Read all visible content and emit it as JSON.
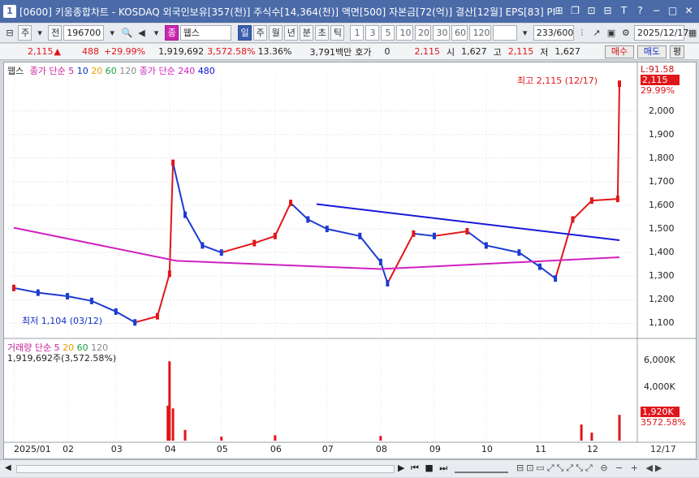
{
  "window": {
    "code": "[0600]",
    "title": "키움종합차트 - KOSDAQ 외국인보유[357(천)] 주식수[14,364(천)] 액면[500] 자본금[72(억)] 결산[12월] EPS[83] PI"
  },
  "toolbar": {
    "market": "주",
    "type": "전",
    "stock_code": "196700",
    "stock_name": "웹스",
    "periods": [
      "일",
      "주",
      "월",
      "년",
      "분",
      "초",
      "틱"
    ],
    "active_period": "일",
    "minute_options": [
      "1",
      "3",
      "5",
      "10",
      "20",
      "30",
      "60",
      "120"
    ],
    "count": "233",
    "count_max": "/600",
    "date": "2025/12/17"
  },
  "quote": {
    "price": "2,115",
    "change": "488",
    "change_pct": "+29.99%",
    "volume": "1,919,692",
    "volume_ratio": "3,572.58%",
    "turnover_pct": "13.36%",
    "amount": "3,791백만",
    "hoga_label": "호가",
    "hoga_value": "0",
    "ask_price": "2,115",
    "open_label": "시",
    "open": "1,627",
    "high_label": "고",
    "high": "2,115",
    "low_label": "저",
    "low": "1,627",
    "buy_label": "매수",
    "sell_label": "매도",
    "eval_label": "평"
  },
  "legend_price": {
    "name": "웹스",
    "ma_label": "종가 단순",
    "ma5": "5",
    "ma10": "10",
    "ma20": "20",
    "ma60": "60",
    "ma120": "120",
    "ma_label2": "종가 단순",
    "ma240": "240",
    "ma480": "480"
  },
  "legend_volume": {
    "name": "거래량",
    "ma_label": "단순",
    "ma5": "5",
    "ma20": "20",
    "ma60": "60",
    "ma120": "120",
    "value": "1,919,692주(3,572.58%)"
  },
  "annotations": {
    "high": "최고 2,115 (12/17)",
    "low": "최저 1,104 (03/12)"
  },
  "price_axis": {
    "top_label": "L:91.58",
    "current": "2,115",
    "current_pct": "29.99%",
    "ticks": [
      "2,000",
      "1,900",
      "1,800",
      "1,700",
      "1,600",
      "1,500",
      "1,400",
      "1,300",
      "1,200",
      "1,100"
    ]
  },
  "volume_axis": {
    "ticks": [
      "6,000K",
      "4,000K"
    ],
    "current": "1,920K",
    "current_pct": "3572.58%"
  },
  "date_axis": {
    "labels": [
      "2025/01",
      "02",
      "03",
      "04",
      "05",
      "06",
      "07",
      "08",
      "09",
      "10",
      "11",
      "12"
    ],
    "right": "12/17"
  },
  "colors": {
    "up": "#e0161a",
    "down": "#1c3bd0",
    "ma5": "#c8209c",
    "ma10": "#1030c8",
    "ma20": "#e8a000",
    "ma60": "#18a040",
    "ma120": "#888888",
    "ma240": "#d020c0",
    "ma480": "#1010d0",
    "trendline": "#1818d8"
  },
  "chart_data": [
    {
      "type": "candlestick",
      "title": "웹스",
      "x_range": [
        "2025/01",
        "2025/12/17"
      ],
      "ylim": [
        1050,
        2150
      ],
      "y_ticks": [
        1100,
        1200,
        1300,
        1400,
        1500,
        1600,
        1700,
        1800,
        1900,
        2000
      ],
      "points": [
        {
          "x": "2025/01",
          "y": 1250
        },
        {
          "x": "2025/01/15",
          "y": 1230
        },
        {
          "x": "2025/02",
          "y": 1215
        },
        {
          "x": "2025/02/15",
          "y": 1195
        },
        {
          "x": "2025/03",
          "y": 1150
        },
        {
          "x": "2025/03/12",
          "y": 1104
        },
        {
          "x": "2025/03/25",
          "y": 1130
        },
        {
          "x": "2025/04/01",
          "y": 1310
        },
        {
          "x": "2025/04/03",
          "y": 1780
        },
        {
          "x": "2025/04/10",
          "y": 1560
        },
        {
          "x": "2025/04/20",
          "y": 1430
        },
        {
          "x": "2025/05",
          "y": 1400
        },
        {
          "x": "2025/05/20",
          "y": 1440
        },
        {
          "x": "2025/06",
          "y": 1470
        },
        {
          "x": "2025/06/10",
          "y": 1610
        },
        {
          "x": "2025/06/20",
          "y": 1540
        },
        {
          "x": "2025/07",
          "y": 1500
        },
        {
          "x": "2025/07/20",
          "y": 1470
        },
        {
          "x": "2025/08",
          "y": 1360
        },
        {
          "x": "2025/08/05",
          "y": 1270
        },
        {
          "x": "2025/08/20",
          "y": 1480
        },
        {
          "x": "2025/09",
          "y": 1470
        },
        {
          "x": "2025/09/20",
          "y": 1490
        },
        {
          "x": "2025/10",
          "y": 1430
        },
        {
          "x": "2025/10/20",
          "y": 1400
        },
        {
          "x": "2025/11",
          "y": 1340
        },
        {
          "x": "2025/11/10",
          "y": 1290
        },
        {
          "x": "2025/11/20",
          "y": 1540
        },
        {
          "x": "2025/12",
          "y": 1620
        },
        {
          "x": "2025/12/16",
          "y": 1627
        },
        {
          "x": "2025/12/17",
          "y": 2115
        }
      ],
      "trendline": [
        {
          "x": "2025/06/25",
          "y": 1605
        },
        {
          "x": "2025/12/17",
          "y": 1452
        }
      ],
      "ma240": [
        {
          "x": "2025/01",
          "y": 1505
        },
        {
          "x": "2025/04/05",
          "y": 1365
        },
        {
          "x": "2025/08",
          "y": 1330
        },
        {
          "x": "2025/12/17",
          "y": 1380
        }
      ]
    },
    {
      "type": "bar",
      "title": "거래량",
      "ylim": [
        0,
        7000
      ],
      "y_ticks": [
        4000,
        6000
      ],
      "y_unit": "K",
      "values": [
        {
          "x": "2025/03/31",
          "y": 2600
        },
        {
          "x": "2025/04/01",
          "y": 5900
        },
        {
          "x": "2025/04/03",
          "y": 2400
        },
        {
          "x": "2025/04/10",
          "y": 800
        },
        {
          "x": "2025/05",
          "y": 300
        },
        {
          "x": "2025/06",
          "y": 400
        },
        {
          "x": "2025/08",
          "y": 350
        },
        {
          "x": "2025/11/25",
          "y": 1200
        },
        {
          "x": "2025/12",
          "y": 600
        },
        {
          "x": "2025/12/17",
          "y": 1920
        }
      ]
    }
  ]
}
